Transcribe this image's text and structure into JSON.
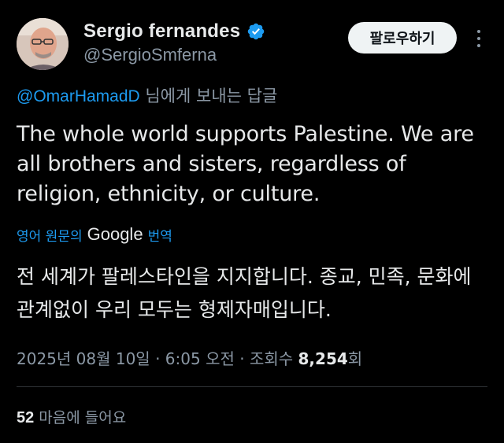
{
  "author": {
    "name": "Sergio fernandes",
    "handle": "@SergioSmferna",
    "verified": true
  },
  "follow_label": "팔로우하기",
  "reply": {
    "mention": "@OmarHamadD",
    "suffix": " 님에게 보내는 답글"
  },
  "tweet_text": "The whole world supports Palestine. We are all brothers and sisters, regardless of religion, ethnicity, or culture.",
  "translation": {
    "prefix": "영어 원문의",
    "provider": "Google",
    "suffix": "번역",
    "text": "전 세계가 팔레스타인을 지지합니다. 종교, 민족, 문화에 관계없이 우리 모두는 형제자매입니다."
  },
  "meta": {
    "date": "2025년 08월 10일",
    "time": "6:05 오전",
    "views_label": "조회수",
    "views": "8,254",
    "views_suffix": "회",
    "separator": "·"
  },
  "likes": {
    "count": "52",
    "label": "마음에 들어요"
  },
  "colors": {
    "background": "#000000",
    "accent": "#1d9bf0",
    "text": "#e7e9ea",
    "muted": "#8b98a5"
  }
}
